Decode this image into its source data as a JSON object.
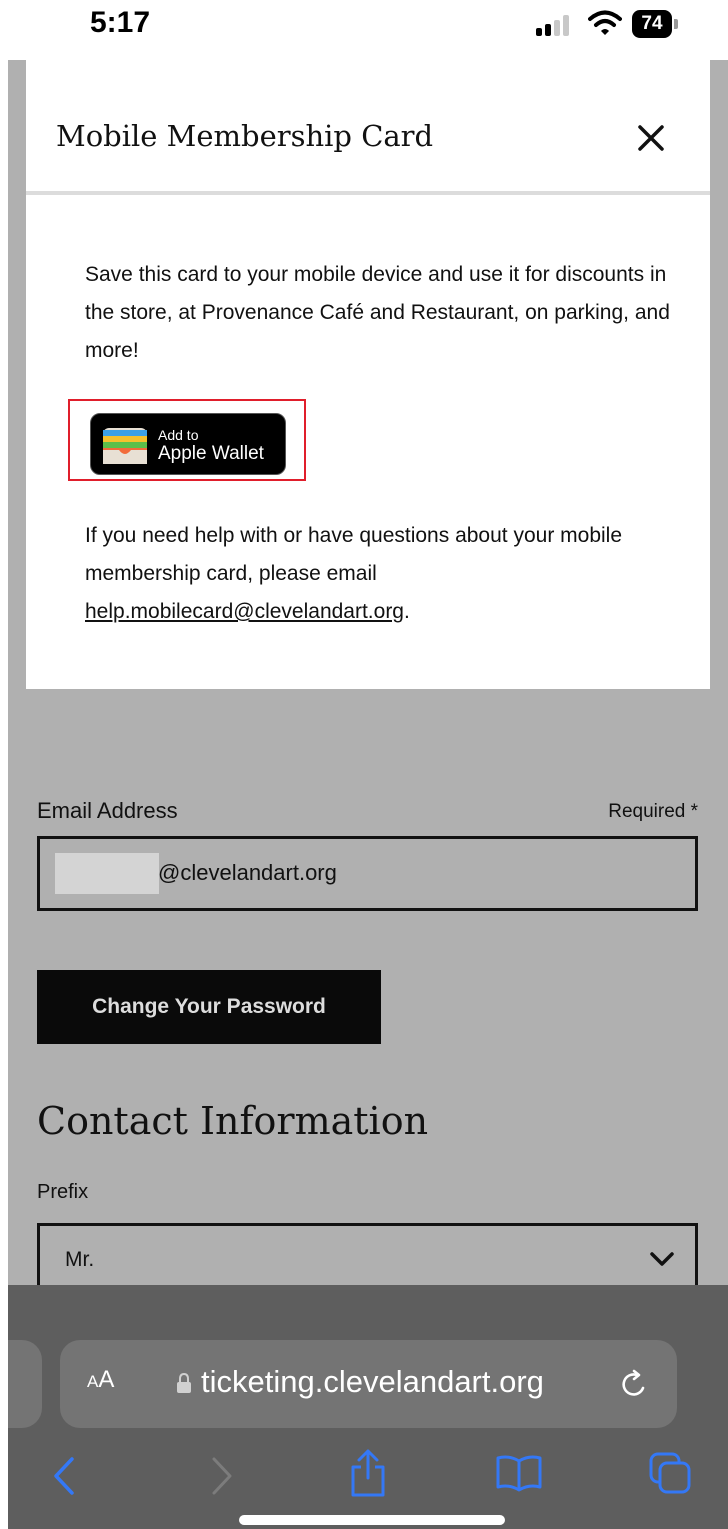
{
  "status_bar": {
    "time": "5:17",
    "battery": "74",
    "signal_icon": "cellular-signal-icon",
    "wifi_icon": "wifi-icon"
  },
  "modal": {
    "title": "Mobile Membership Card",
    "close_icon": "close-icon",
    "intro_text": "Save this card to your mobile device and use it for discounts in the store, at Provenance Café and Restaurant, on parking, and more!",
    "wallet_button": {
      "small_label": "Add to",
      "big_label": "Apple Wallet",
      "icon": "wallet-icon",
      "highlight_color": "#e01e2b"
    },
    "help_text": "If you need help with or have questions about your mobile membership card, please email",
    "help_email": "help.mobilecard@clevelandart.org",
    "help_suffix": "."
  },
  "account_form": {
    "email_label": "Email Address",
    "required_label": "Required *",
    "email_value_visible": "@clevelandart.org",
    "change_password_label": "Change Your Password",
    "contact_heading": "Contact Information",
    "prefix_label": "Prefix",
    "prefix_value": "Mr."
  },
  "browser": {
    "text_size_label_small": "A",
    "text_size_label_big": "A",
    "url": "ticketing.clevelandart.org",
    "accent_color": "#3478f6",
    "icons": [
      "back-icon",
      "forward-icon",
      "share-icon",
      "bookmarks-icon",
      "tabs-icon",
      "reload-icon",
      "lock-icon"
    ]
  },
  "colors": {
    "overlay_background": "#b0b0b0",
    "button_dark": "#0a0a0a",
    "browser_chrome": "#5e5e5e"
  }
}
